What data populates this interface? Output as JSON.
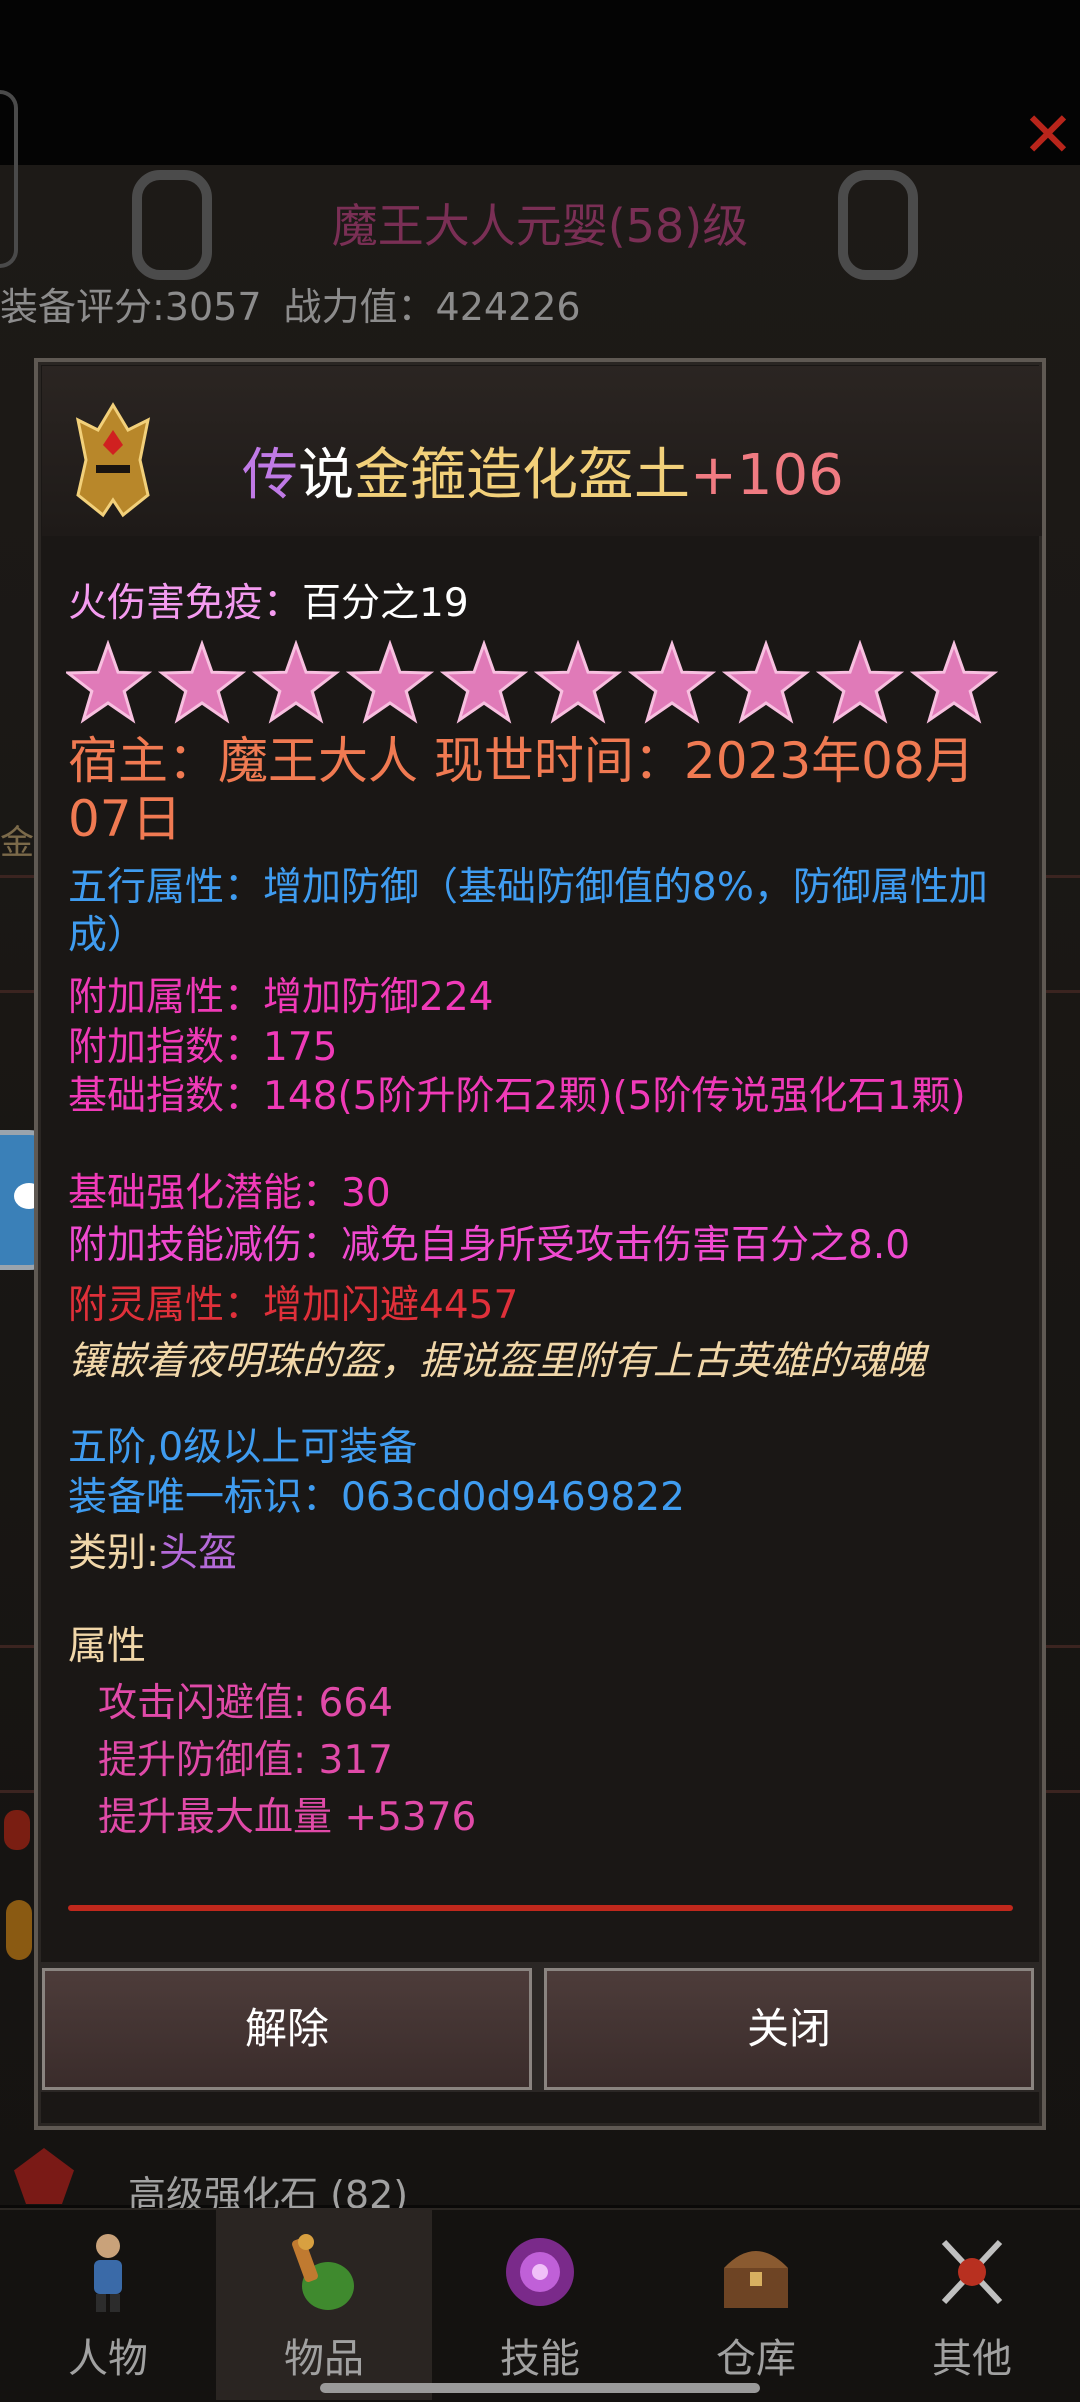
{
  "window": {
    "title": "魔王大人元婴(58)级",
    "score_label": "装备评分:3057",
    "power_label": "战力值：424226",
    "side_gold": "金",
    "close_icon": "close-x-icon"
  },
  "item": {
    "title_parts": [
      "传",
      "说",
      "金箍造化盔土",
      "+106"
    ],
    "fire_label": "火伤害免疫：",
    "fire_value": "百分之19",
    "stars": 10,
    "host_line": "宿主：魔王大人 现世时间：2023年08月07日",
    "five_elements": "五行属性：增加防御（基础防御值的8%，防御属性加成）",
    "extra_attr": "附加属性：增加防御224",
    "extra_index": "附加指数：175",
    "base_index": "基础指数：148(5阶升阶石2颗)(5阶传说强化石1颗)",
    "base_potential": "基础强化潜能：30",
    "skill_reduce": "附加技能减伤：减免自身所受攻击伤害百分之8.0",
    "spirit_attr": "附灵属性：增加闪避4457",
    "description": "镶嵌着夜明珠的盔，据说盔里附有上古英雄的魂魄",
    "equip_req": "五阶,0级以上可装备",
    "unique_id": "装备唯一标识：063cd0d9469822",
    "category_label": "类别:",
    "category_value": "头盔",
    "attr_title": "属性",
    "attrs": [
      "攻击闪避值: 664",
      "提升防御值: 317",
      "提升最大血量 +5376"
    ]
  },
  "buttons": {
    "remove": "解除",
    "close": "关闭"
  },
  "background_item": "高级强化石 (82)",
  "tabs": [
    {
      "label": "人物",
      "icon": "character-icon"
    },
    {
      "label": "物品",
      "icon": "items-bag-icon"
    },
    {
      "label": "技能",
      "icon": "skill-orb-icon"
    },
    {
      "label": "仓库",
      "icon": "chest-icon"
    },
    {
      "label": "其他",
      "icon": "other-swords-icon"
    }
  ],
  "active_tab": 1,
  "colors": {
    "accent_pink": "#f03ab8",
    "blue_text": "#3f9cf0",
    "host_orange": "#f07a52",
    "divider_red": "#c0281c"
  }
}
